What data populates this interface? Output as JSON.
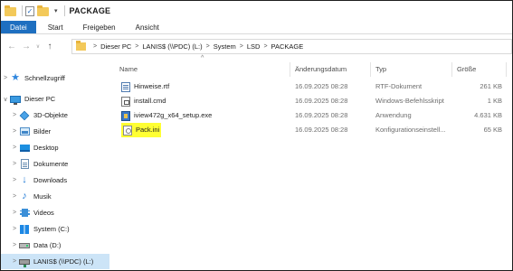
{
  "window": {
    "title": "PACKAGE",
    "quick_access_dropdown": "▾"
  },
  "ribbon": {
    "tabs": [
      "Datei",
      "Start",
      "Freigeben",
      "Ansicht"
    ]
  },
  "navigation_buttons": {
    "back": "←",
    "forward": "→",
    "recent": "∨",
    "up": "↑"
  },
  "address": {
    "crumbs": [
      "Dieser PC",
      "LANIS$ (\\\\PDC) (L:)",
      "System",
      "LSD",
      "PACKAGE"
    ],
    "separator": ">"
  },
  "nav_pane": {
    "items": [
      {
        "label": "Schnellzugriff",
        "icon": "star-icon",
        "chevron": ">"
      },
      {
        "label": "Dieser PC",
        "icon": "computer-icon",
        "chevron": "∨"
      },
      {
        "label": "3D-Objekte",
        "icon": "3d-objects-icon",
        "chevron": ">"
      },
      {
        "label": "Bilder",
        "icon": "pictures-icon",
        "chevron": ">"
      },
      {
        "label": "Desktop",
        "icon": "desktop-icon",
        "chevron": ">"
      },
      {
        "label": "Dokumente",
        "icon": "documents-icon",
        "chevron": ">"
      },
      {
        "label": "Downloads",
        "icon": "downloads-icon",
        "chevron": ">"
      },
      {
        "label": "Musik",
        "icon": "music-icon",
        "chevron": ">"
      },
      {
        "label": "Videos",
        "icon": "videos-icon",
        "chevron": ">"
      },
      {
        "label": "System (C:)",
        "icon": "windows-drive-icon",
        "chevron": ">"
      },
      {
        "label": "Data (D:)",
        "icon": "drive-icon",
        "chevron": ">"
      },
      {
        "label": "LANIS$ (\\\\PDC) (L:)",
        "icon": "network-drive-icon",
        "chevron": ">",
        "selected": true
      }
    ]
  },
  "file_list": {
    "sort_indicator": "^",
    "columns": [
      "Name",
      "Änderungsdatum",
      "Typ",
      "Größe"
    ],
    "rows": [
      {
        "name": "Hinweise.rtf",
        "date": "16.09.2025 08:28",
        "type": "RTF-Dokument",
        "size": "261 KB",
        "icon": "rtf-file-icon"
      },
      {
        "name": "install.cmd",
        "date": "16.09.2025 08:28",
        "type": "Windows-Befehlsskript",
        "size": "1 KB",
        "icon": "cmd-file-icon"
      },
      {
        "name": "iview472g_x64_setup.exe",
        "date": "16.09.2025 08:28",
        "type": "Anwendung",
        "size": "4.631 KB",
        "icon": "exe-file-icon"
      },
      {
        "name": "Pack.ini",
        "date": "16.09.2025 08:28",
        "type": "Konfigurationseinstell...",
        "size": "65 KB",
        "icon": "ini-file-icon",
        "highlighted": true
      }
    ]
  },
  "colors": {
    "file_tab": "#1e6fc0",
    "selected_nav": "#cce4f7",
    "highlight": "#ffff33"
  }
}
